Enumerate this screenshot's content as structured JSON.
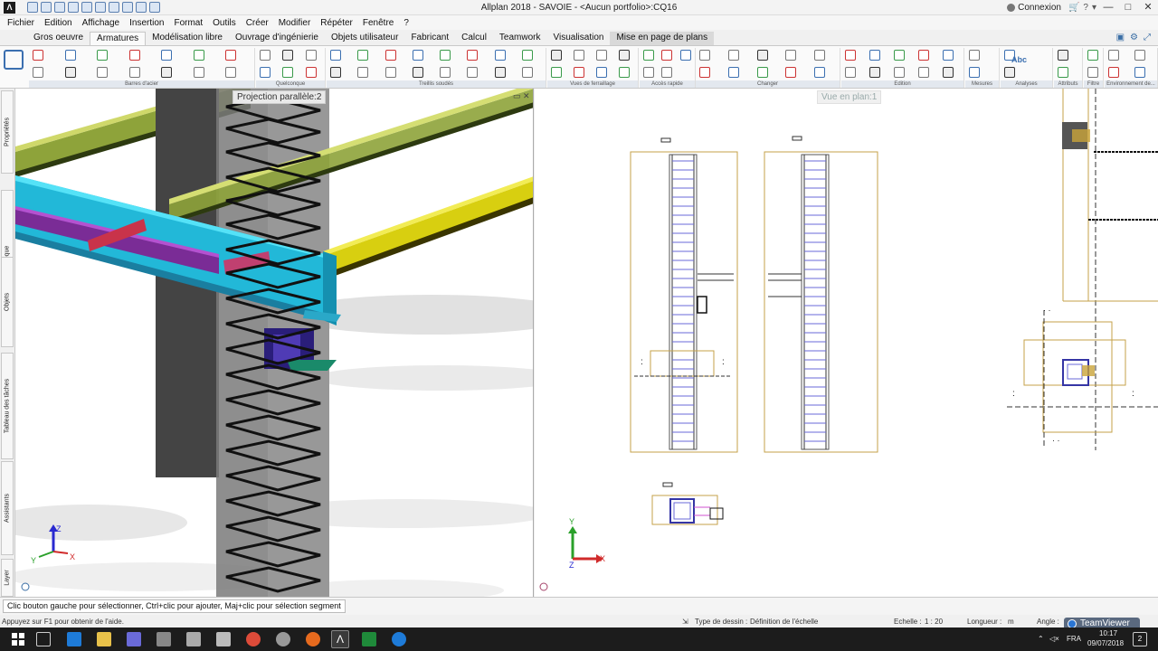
{
  "window": {
    "title": "Allplan 2018 - SAVOIE - <Aucun portfolio>:CQ16",
    "connexion_label": "Connexion",
    "controls": [
      "—",
      "□",
      "✕"
    ]
  },
  "menu": [
    "Fichier",
    "Edition",
    "Affichage",
    "Insertion",
    "Format",
    "Outils",
    "Créer",
    "Modifier",
    "Répéter",
    "Fenêtre",
    "?"
  ],
  "ribbon_tabs": [
    {
      "label": "Gros oeuvre",
      "state": "normal"
    },
    {
      "label": "Armatures",
      "state": "active"
    },
    {
      "label": "Modélisation libre",
      "state": "normal"
    },
    {
      "label": "Ouvrage d'ingénierie",
      "state": "normal"
    },
    {
      "label": "Objets utilisateur",
      "state": "normal"
    },
    {
      "label": "Fabricant",
      "state": "normal"
    },
    {
      "label": "Calcul",
      "state": "normal"
    },
    {
      "label": "Teamwork",
      "state": "normal"
    },
    {
      "label": "Visualisation",
      "state": "normal"
    },
    {
      "label": "Mise en page de plans",
      "state": "highlight"
    }
  ],
  "ribbon_groups": [
    {
      "label": "Barres d'acier"
    },
    {
      "label": "Quelconque"
    },
    {
      "label": "Treillis soudés"
    },
    {
      "label": "Vues de ferraillage"
    },
    {
      "label": "Accès rapide"
    },
    {
      "label": "Changer"
    },
    {
      "label": "Edition"
    },
    {
      "label": "Mesures"
    },
    {
      "label": "Analyses"
    },
    {
      "label": "Attributs"
    },
    {
      "label": "Filtre"
    },
    {
      "label": "Environnement de..."
    }
  ],
  "analyses_icon_text": "Abc",
  "left_palette": [
    "Propriétés",
    "Bibliothèque",
    "Objets",
    "Tableau des tâches",
    "Assistants",
    "Layer"
  ],
  "viewports": {
    "view3d_caption": "Projection parallèle:2",
    "view2d_caption": "Vue en plan:1"
  },
  "axes": {
    "x": "X",
    "y": "Y",
    "z": "Z"
  },
  "prompt": "Clic bouton gauche pour sélectionner, Ctrl+clic pour ajouter, Maj+clic pour sélection segment",
  "status": {
    "help": "Appuyez sur F1 pour obtenir de l'aide.",
    "type_dessin_label": "Type de dessin :",
    "type_dessin_value": "Définition de l'échelle",
    "echelle_label": "Echelle :",
    "echelle_value": "1 : 20",
    "longueur_label": "Longueur :",
    "longueur_value": "m",
    "angle_label": "Angle :"
  },
  "taskbar": {
    "language": "FRA",
    "time": "10:17",
    "date": "09/07/2018",
    "teamviewer": "TeamViewer",
    "notif_count": "2"
  }
}
